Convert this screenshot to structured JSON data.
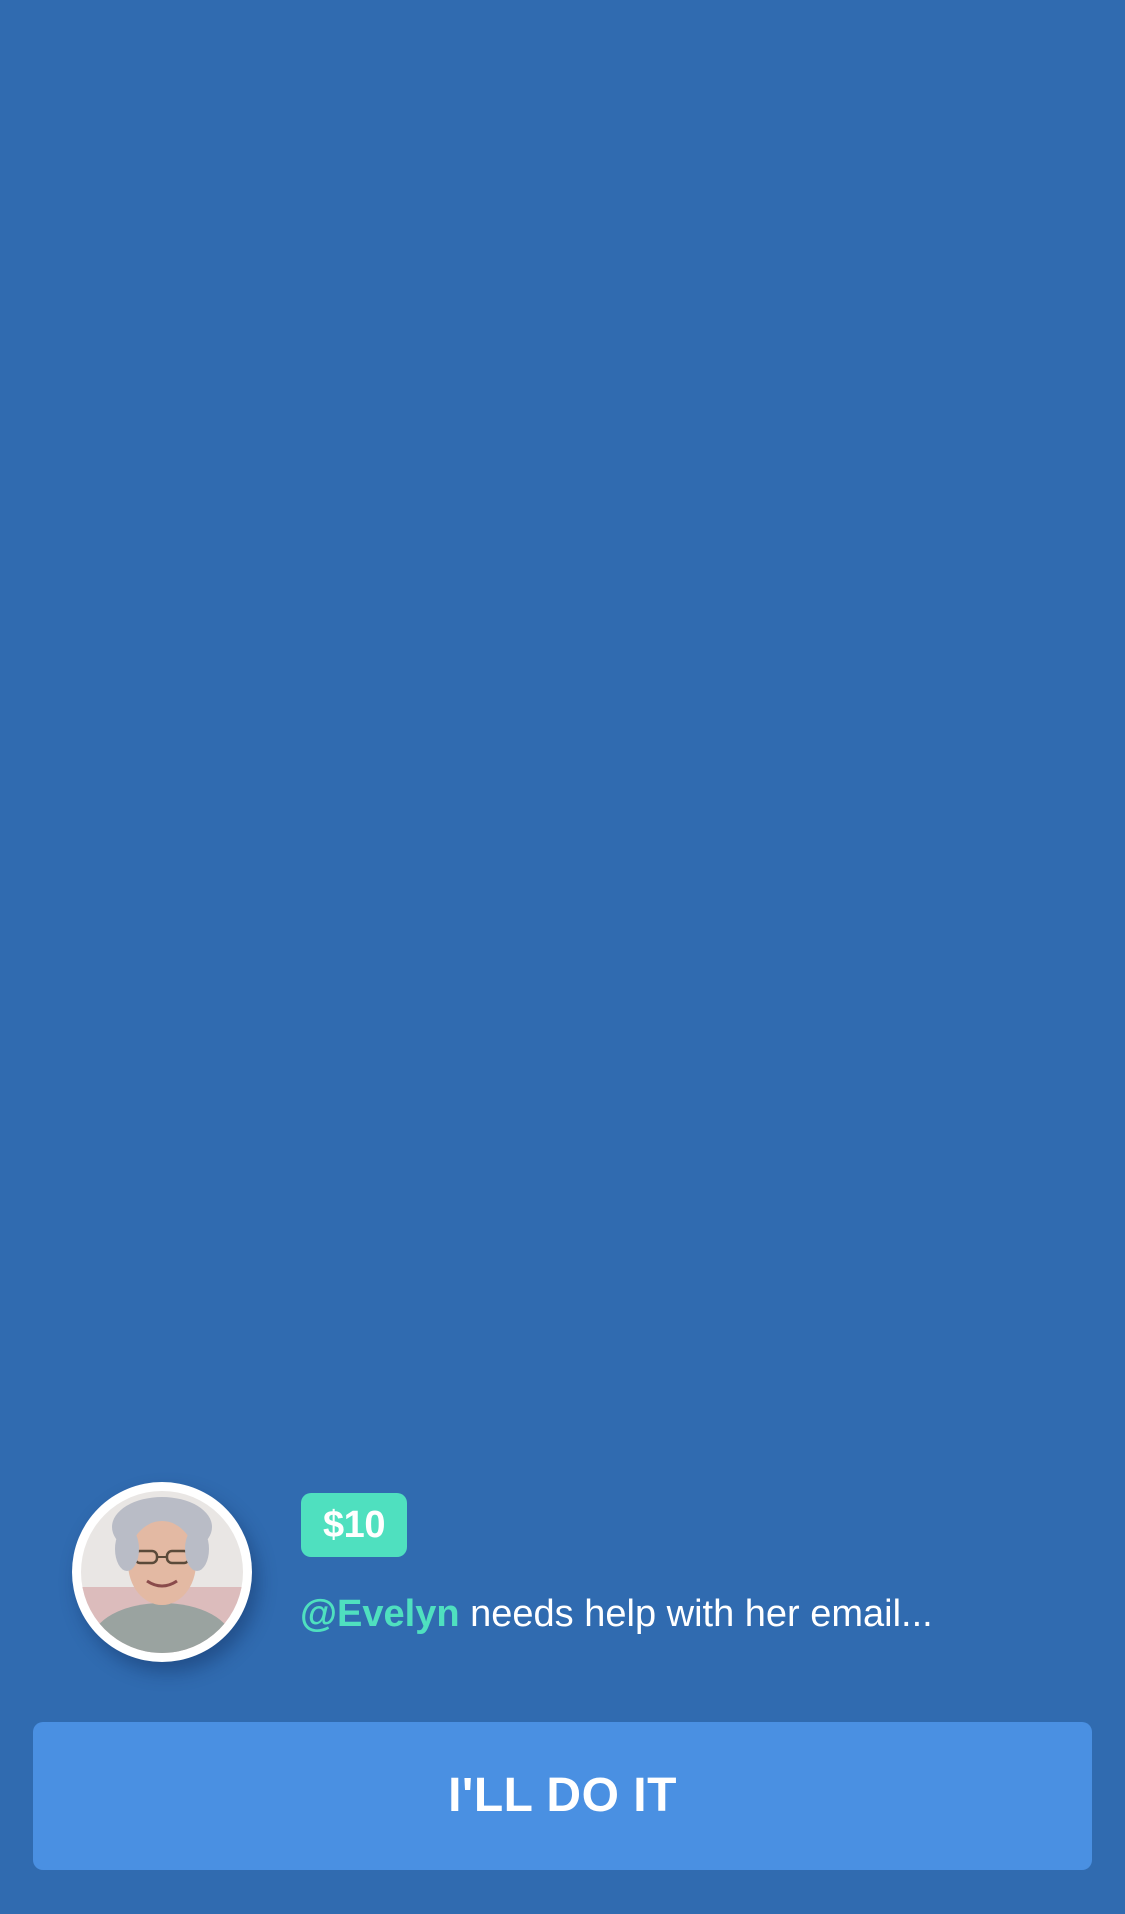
{
  "task": {
    "price": "$10",
    "handle": "@Evelyn",
    "description": "needs help with her email..."
  },
  "cta": {
    "label": "I'LL DO IT"
  },
  "colors": {
    "background": "#306bb0",
    "accent": "#4fe0bf",
    "button": "#4a90e2",
    "text": "#ffffff"
  },
  "avatar": {
    "icon": "user-avatar-photo"
  }
}
